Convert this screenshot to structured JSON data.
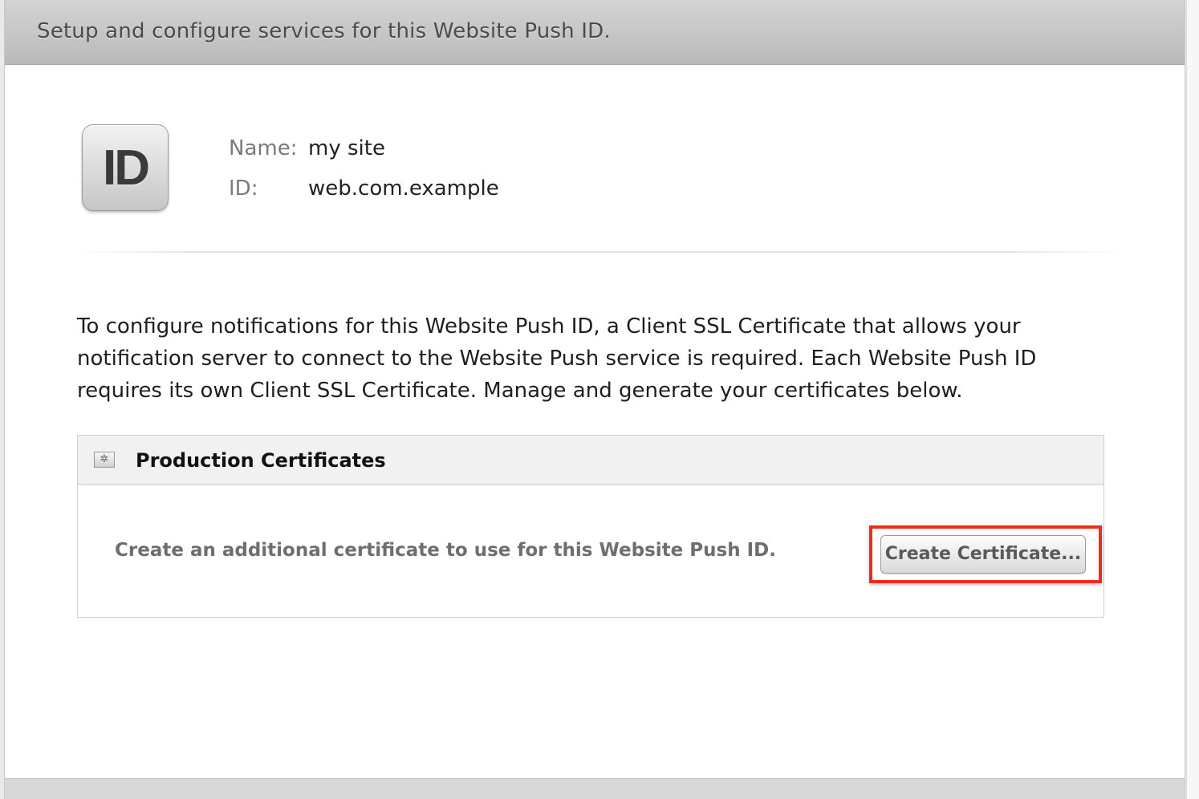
{
  "header": {
    "title": "Setup and configure services for this Website Push ID."
  },
  "identity": {
    "badge_text": "ID",
    "name_label": "Name:",
    "name_value": "my site",
    "id_label": "ID:",
    "id_value": "web.com.example"
  },
  "description": "To configure notifications for this Website Push ID, a Client SSL Certificate that allows your notification server to connect to the Website Push service is required. Each Website Push ID requires its own Client SSL Certificate. Manage and generate your certificates below.",
  "production_certificates": {
    "icon": "certificate-icon",
    "title": "Production Certificates",
    "description": "Create an additional certificate to use for this Website Push ID.",
    "create_button_label": "Create Certificate..."
  },
  "colors": {
    "highlight": "#ee2b1c",
    "header_bg": "#c6c6c6"
  }
}
